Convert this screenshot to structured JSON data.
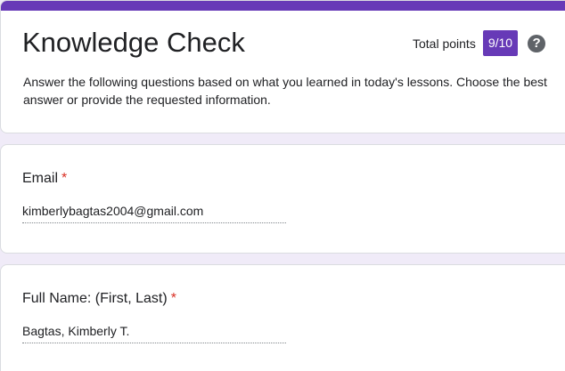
{
  "header": {
    "title": "Knowledge Check",
    "points_label": "Total points",
    "points_value": "9/10",
    "help_icon": "help-circle-icon",
    "description": "Answer the following questions based on what you learned in today's lessons. Choose the best answer or provide the requested information.",
    "accent_color": "#673ab7"
  },
  "questions": [
    {
      "label": "Email",
      "required_marker": "*",
      "answer": "kimberlybagtas2004@gmail.com"
    },
    {
      "label": "Full Name: (First, Last)",
      "required_marker": "*",
      "answer": "Bagtas, Kimberly T."
    }
  ],
  "colors": {
    "background": "#f0ebf8",
    "required": "#d93025"
  }
}
